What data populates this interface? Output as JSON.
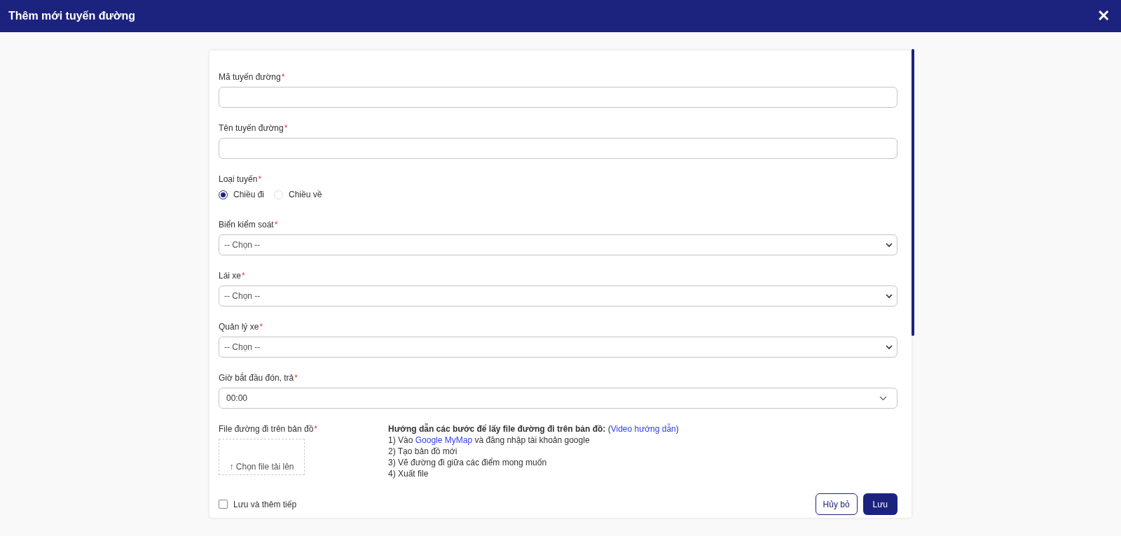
{
  "window": {
    "title": "Thêm mới tuyến đường",
    "close": "✕"
  },
  "fields": [
    {
      "kind": "text",
      "label": "Mã tuyến đường",
      "required_mark": "*"
    },
    {
      "kind": "text",
      "label": "Tên tuyến đường",
      "required_mark": "*"
    },
    {
      "kind": "radio",
      "label": "Loại tuyến",
      "required_mark": "*",
      "options": [
        {
          "label": "Chiều đi",
          "selected": true
        },
        {
          "label": "Chiều về",
          "selected": false
        }
      ]
    },
    {
      "kind": "select",
      "label": "Biển kiểm soát",
      "required_mark": "*",
      "value": "-- Chọn --"
    },
    {
      "kind": "select",
      "label": "Lái xe",
      "required_mark": "*",
      "value": "-- Chọn --"
    },
    {
      "kind": "select",
      "label": "Quản lý xe",
      "required_mark": "*",
      "value": "-- Chọn --"
    },
    {
      "kind": "time",
      "label": "Giờ bắt đầu đón, trả",
      "required_mark": "*",
      "value": "00:00"
    }
  ],
  "file_upload": {
    "label": "File đường đi trên bản đồ",
    "required_mark": "*",
    "button": "↑ Chọn file tải lên"
  },
  "guide": {
    "heading": "Hướng dẫn các bước để lấy file đường đi trên bản đồ:",
    "heading_link": [
      {
        "text": "(",
        "link": false
      },
      {
        "text": "Video hướng dẫn",
        "link": true
      },
      {
        "text": ")",
        "link": false
      }
    ],
    "steps": [
      [
        {
          "text": "1) Vào ",
          "link": false
        },
        {
          "text": "Google MyMap",
          "link": true
        },
        {
          "text": " và đăng nhập tài khoản google",
          "link": false
        }
      ],
      [
        {
          "text": "2) Tạo bản đồ mới",
          "link": false
        }
      ],
      [
        {
          "text": "3) Vẽ đường đi giữa các điểm mong muốn",
          "link": false
        }
      ],
      [
        {
          "text": "4) Xuất file",
          "link": false
        }
      ]
    ]
  },
  "footer": {
    "save_and_continue": {
      "label": "Lưu và thêm tiếp",
      "checked": false
    },
    "buttons": [
      {
        "kind": "outline",
        "label": "Hủy bỏ"
      },
      {
        "kind": "primary",
        "label": "Lưu"
      }
    ]
  }
}
